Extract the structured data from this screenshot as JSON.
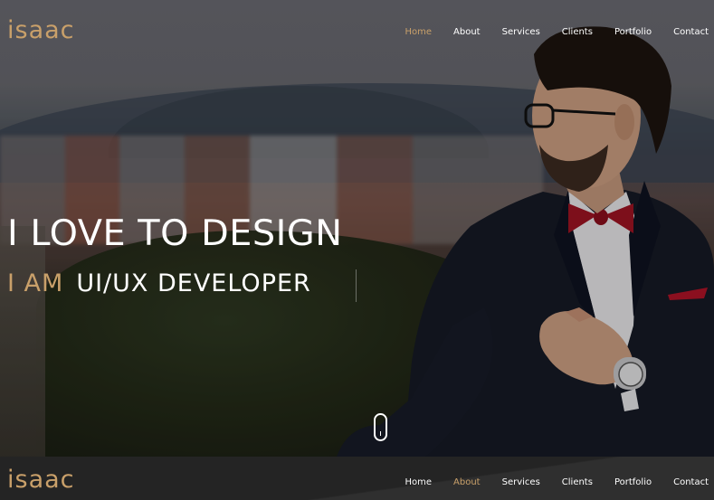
{
  "brand": {
    "logo_top": "isaac",
    "logo_bottom": "isaac",
    "accent_color": "#c9a06a"
  },
  "nav_top": {
    "items": [
      {
        "label": "Home",
        "active": true
      },
      {
        "label": "About",
        "active": false
      },
      {
        "label": "Services",
        "active": false
      },
      {
        "label": "Clients",
        "active": false
      },
      {
        "label": "Portfolio",
        "active": false
      },
      {
        "label": "Contact",
        "active": false
      }
    ]
  },
  "nav_bottom": {
    "items": [
      {
        "label": "Home",
        "active": false
      },
      {
        "label": "About",
        "active": true
      },
      {
        "label": "Services",
        "active": false
      },
      {
        "label": "Clients",
        "active": false
      },
      {
        "label": "Portfolio",
        "active": false
      },
      {
        "label": "Contact",
        "active": false
      }
    ]
  },
  "hero": {
    "headline": "I LOVE TO DESIGN",
    "prefix": "I AM",
    "role": "UI/UX DEVELOPER",
    "scroll_icon": "mouse-scroll-icon"
  }
}
